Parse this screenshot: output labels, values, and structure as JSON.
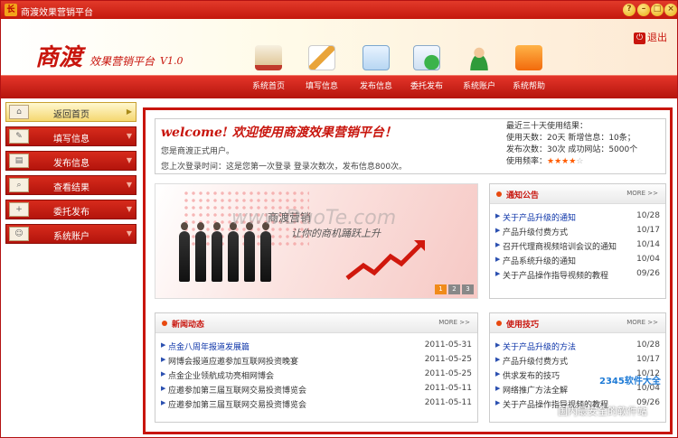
{
  "window": {
    "title": "商渡效果营销平台",
    "controls": [
      "?",
      "–",
      "□",
      "×"
    ]
  },
  "header": {
    "brand": "商渡",
    "subbrand": "效果营销平台",
    "version": "V1.0",
    "logout": "退出"
  },
  "nav": [
    {
      "label": "系统首页",
      "icon": "house-icon"
    },
    {
      "label": "填写信息",
      "icon": "pencil-icon"
    },
    {
      "label": "发布信息",
      "icon": "document-icon"
    },
    {
      "label": "委托发布",
      "icon": "add-document-icon"
    },
    {
      "label": "系统账户",
      "icon": "user-icon"
    },
    {
      "label": "系统帮助",
      "icon": "rss-icon"
    }
  ],
  "sidebar": [
    {
      "label": "返回首页",
      "icon": "house-icon"
    },
    {
      "label": "填写信息",
      "icon": "pencil-icon"
    },
    {
      "label": "发布信息",
      "icon": "document-icon"
    },
    {
      "label": "查看结果",
      "icon": "magnifier-icon"
    },
    {
      "label": "委托发布",
      "icon": "add-document-icon"
    },
    {
      "label": "系统账户",
      "icon": "user-icon"
    }
  ],
  "welcome": {
    "title": "welcome!  欢迎使用商渡效果营销平台！",
    "line1": "您是商渡正式用户。",
    "line2": "您上次登录时间：这是您第一次登录 登录次数次，发布信息800次。",
    "stats_title": "最近三十天使用结果：",
    "stats_line1": "使用天数：20天  新增信息：10条；",
    "stats_line2": "发布次数：30次  成功网站：5000个",
    "stats_freq_label": "使用频率：",
    "rating": 4,
    "rating_max": 5
  },
  "banner": {
    "slogan1": "商渡营销",
    "slogan2": "让你的商机踊跃上升",
    "pages": [
      "1",
      "2",
      "3"
    ]
  },
  "notice": {
    "title": "通知公告",
    "more": "MORE >>",
    "items": [
      {
        "text": "关于产品升级的通知",
        "date": "10/28"
      },
      {
        "text": "产品升级付费方式",
        "date": "10/17"
      },
      {
        "text": "召开代理商视频培训会议的通知",
        "date": "10/14"
      },
      {
        "text": "产品系统升级的通知",
        "date": "10/04"
      },
      {
        "text": "关于产品操作指导视频的教程",
        "date": "09/26"
      }
    ]
  },
  "news": {
    "title": "新闻动态",
    "more": "MORE >>",
    "items": [
      {
        "text": "点金八周年报道发展篇",
        "date": "2011-05-31"
      },
      {
        "text": "网博会报道应邀参加互联网投资晚宴",
        "date": "2011-05-25"
      },
      {
        "text": "点金企业领航成功亮相网博会",
        "date": "2011-05-25"
      },
      {
        "text": "应邀参加第三届互联网交易投资博览会",
        "date": "2011-05-11"
      },
      {
        "text": "应邀参加第三届互联网交易投资博览会",
        "date": "2011-05-11"
      }
    ]
  },
  "tips": {
    "title": "使用技巧",
    "more": "MORE >>",
    "items": [
      {
        "text": "关于产品升级的方法",
        "date": "10/28"
      },
      {
        "text": "产品升级付费方式",
        "date": "10/17"
      },
      {
        "text": "供求发布的技巧",
        "date": "10/12"
      },
      {
        "text": "网络推广方法全解",
        "date": "10/04"
      },
      {
        "text": "关于产品操作指导视频的教程",
        "date": "09/26"
      }
    ]
  },
  "watermark": {
    "main": "www.DuoTe.com",
    "side": "2345软件大全",
    "bottom": "国内最安全的软件站"
  },
  "colors": {
    "primary": "#c8150d",
    "accent": "#f3a319",
    "link": "#0b33a8"
  }
}
